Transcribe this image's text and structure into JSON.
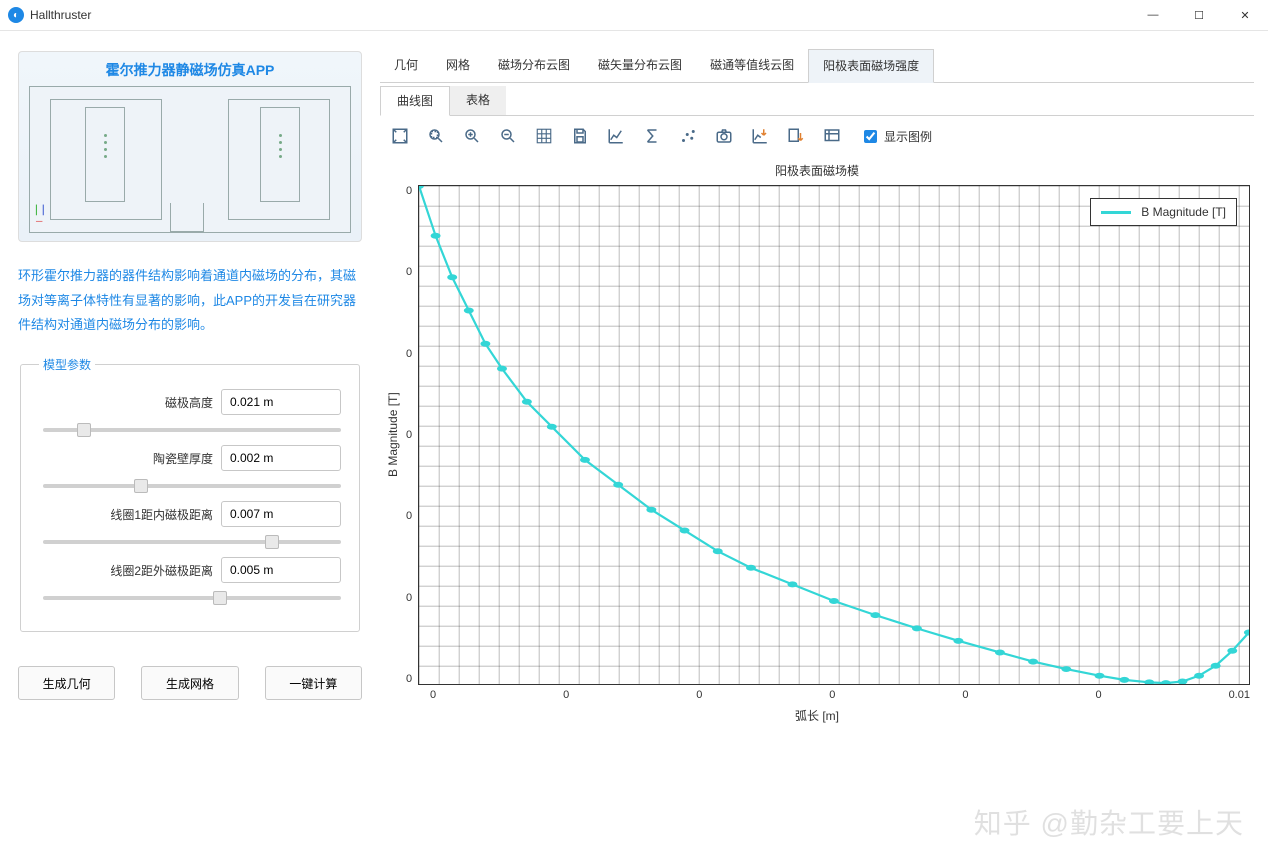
{
  "window": {
    "title": "Hallthruster",
    "min": "—",
    "max": "☐",
    "close": "✕"
  },
  "preview": {
    "title": "霍尔推力器静磁场仿真APP"
  },
  "description": "环形霍尔推力器的器件结构影响着通道内磁场的分布，其磁场对等离子体特性有显著的影响，此APP的开发旨在研究器件结构对通道内磁场分布的影响。",
  "params": {
    "legend": "模型参数",
    "items": [
      {
        "label": "磁极高度",
        "value": "0.021 m",
        "slider": 12
      },
      {
        "label": "陶瓷壁厚度",
        "value": "0.002 m",
        "slider": 32
      },
      {
        "label": "线圈1距内磁极距离",
        "value": "0.007 m",
        "slider": 78
      },
      {
        "label": "线圈2距外磁极距离",
        "value": "0.005 m",
        "slider": 60
      }
    ]
  },
  "actions": {
    "gen_geom": "生成几何",
    "gen_mesh": "生成网格",
    "compute": "一键计算"
  },
  "main_tabs": [
    {
      "label": "几何",
      "active": false
    },
    {
      "label": "网格",
      "active": false
    },
    {
      "label": "磁场分布云图",
      "active": false
    },
    {
      "label": "磁矢量分布云图",
      "active": false
    },
    {
      "label": "磁通等值线云图",
      "active": false
    },
    {
      "label": "阳极表面磁场强度",
      "active": true
    }
  ],
  "sub_tabs": [
    {
      "label": "曲线图",
      "active": true
    },
    {
      "label": "表格",
      "active": false
    }
  ],
  "toolbar": {
    "icons": [
      "zoom-extents-icon",
      "zoom-window-icon",
      "zoom-in-icon",
      "zoom-out-icon",
      "grid-icon",
      "save-icon",
      "line-plot-icon",
      "sigma-icon",
      "scatter-icon",
      "camera-icon",
      "export-plot-icon",
      "export-data-icon",
      "settings-plot-icon"
    ],
    "legend_label": "显示图例",
    "legend_checked": true
  },
  "chart": {
    "title": "阳极表面磁场模",
    "ylabel": "B Magnitude [T]",
    "xlabel": "弧长 [m]",
    "yticks": [
      "0",
      "0",
      "0",
      "0",
      "0",
      "0",
      "0"
    ],
    "xticks": [
      "0",
      "0",
      "0",
      "0",
      "0",
      "0",
      "0.01"
    ],
    "legend_entry": "B Magnitude [T]"
  },
  "chart_data": {
    "type": "line",
    "title": "阳极表面磁场模",
    "xlabel": "弧长 [m]",
    "ylabel": "B Magnitude [T]",
    "xlim": [
      0,
      0.01
    ],
    "ylim": [
      0,
      6
    ],
    "series": [
      {
        "name": "B Magnitude [T]",
        "color": "#33d6d6",
        "x_norm": [
          0.0,
          0.02,
          0.04,
          0.06,
          0.08,
          0.1,
          0.13,
          0.16,
          0.2,
          0.24,
          0.28,
          0.32,
          0.36,
          0.4,
          0.45,
          0.5,
          0.55,
          0.6,
          0.65,
          0.7,
          0.74,
          0.78,
          0.82,
          0.85,
          0.88,
          0.9,
          0.92,
          0.94,
          0.96,
          0.98,
          1.0
        ],
        "y_norm": [
          6.0,
          5.4,
          4.9,
          4.5,
          4.1,
          3.8,
          3.4,
          3.1,
          2.7,
          2.4,
          2.1,
          1.85,
          1.6,
          1.4,
          1.2,
          1.0,
          0.83,
          0.67,
          0.52,
          0.38,
          0.27,
          0.18,
          0.1,
          0.05,
          0.02,
          0.01,
          0.03,
          0.1,
          0.22,
          0.4,
          0.62
        ]
      }
    ]
  },
  "watermark": "知乎 @勤杂工要上天"
}
